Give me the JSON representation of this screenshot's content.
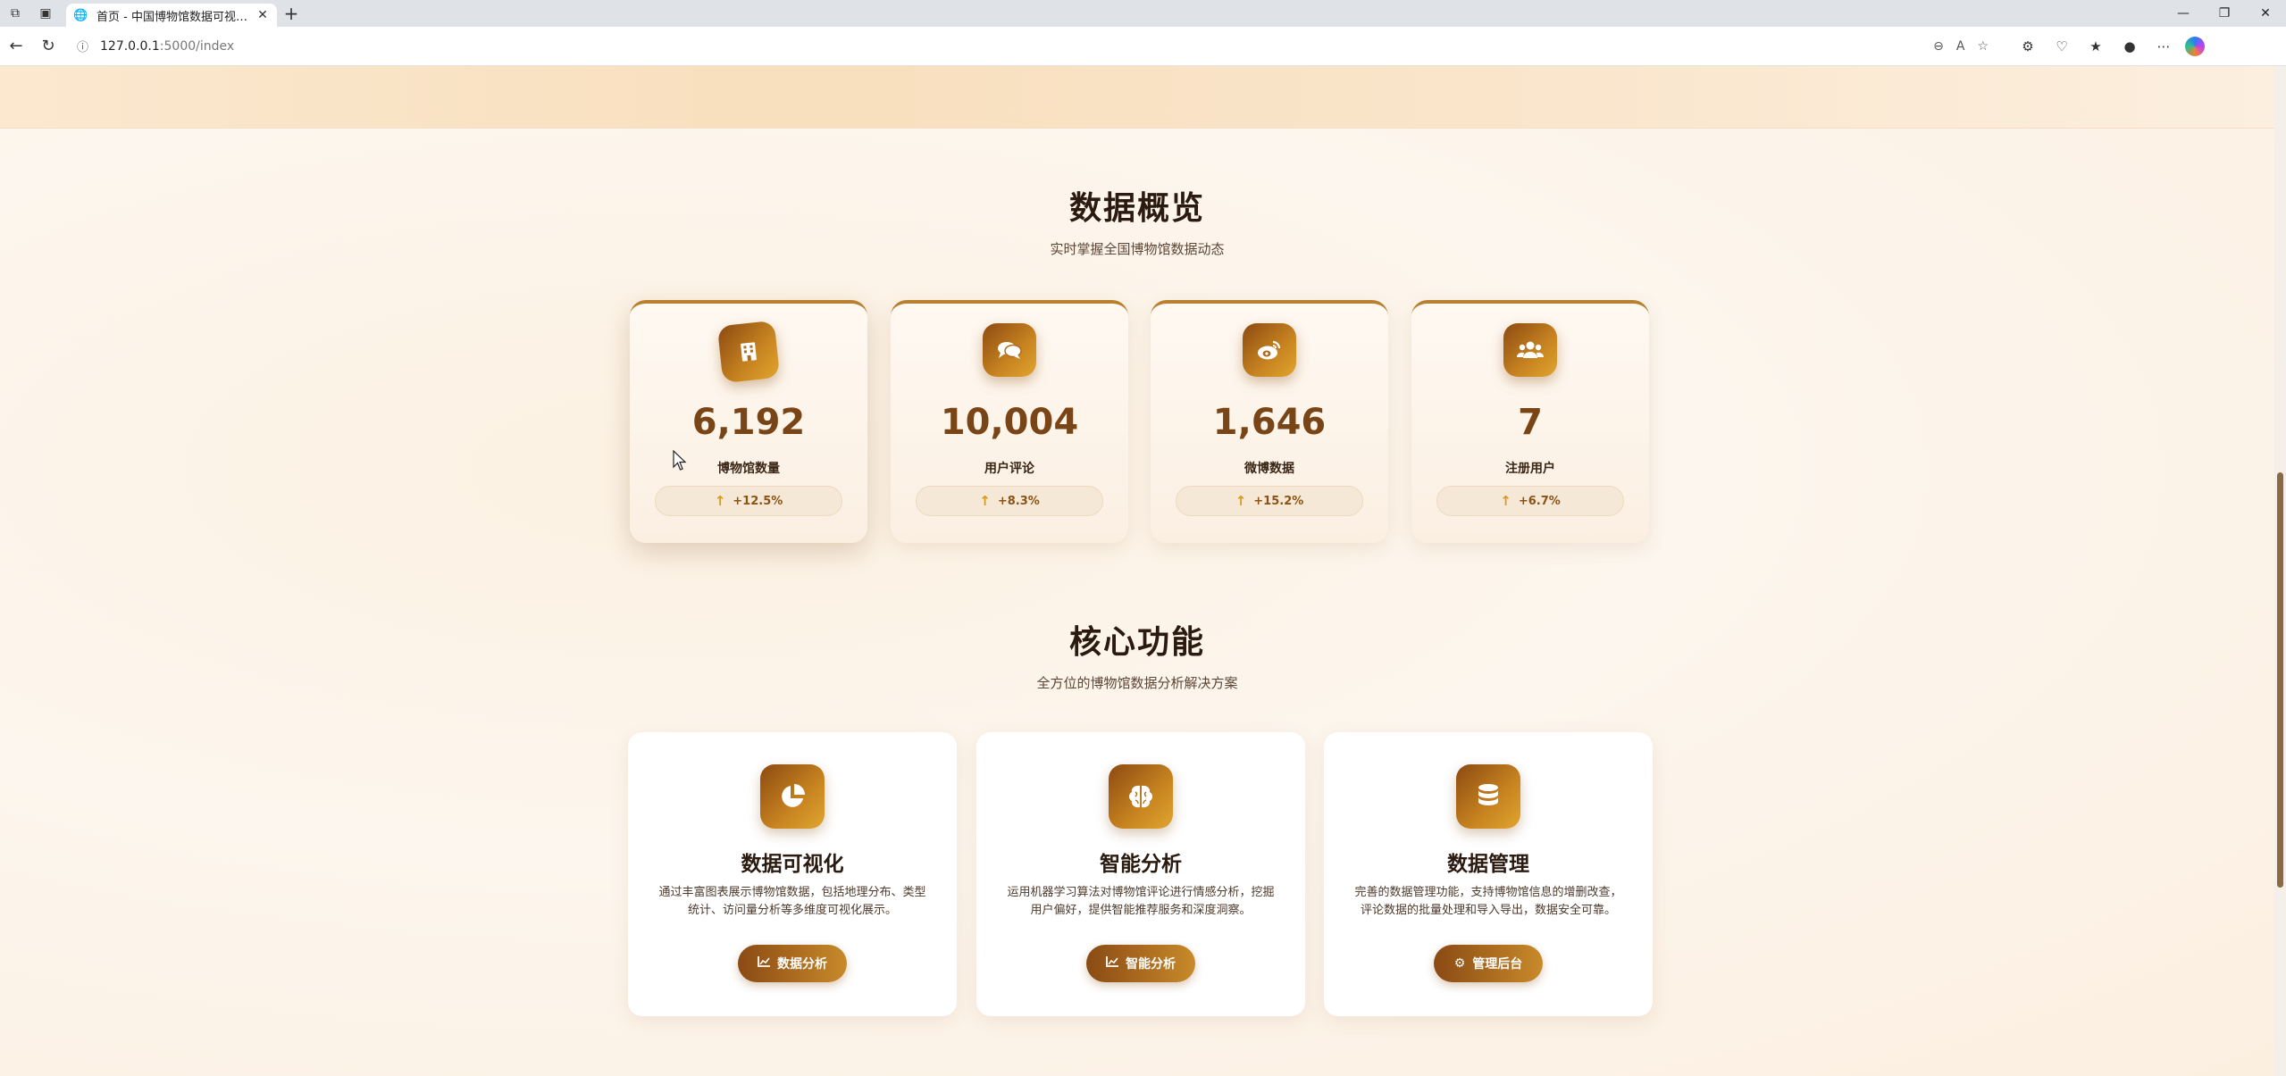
{
  "browser": {
    "tab_title": "首页 - 中国博物馆数据可视化分析",
    "url_host": "127.0.0.1",
    "url_path": ":5000/index"
  },
  "overview": {
    "title": "数据概览",
    "subtitle": "实时掌握全国博物馆数据动态",
    "stats": [
      {
        "value": "6,192",
        "label": "博物馆数量",
        "trend": "+12.5%",
        "icon": "building-icon"
      },
      {
        "value": "10,004",
        "label": "用户评论",
        "trend": "+8.3%",
        "icon": "comments-icon"
      },
      {
        "value": "1,646",
        "label": "微博数据",
        "trend": "+15.2%",
        "icon": "weibo-icon"
      },
      {
        "value": "7",
        "label": "注册用户",
        "trend": "+6.7%",
        "icon": "users-icon"
      }
    ]
  },
  "features": {
    "title": "核心功能",
    "subtitle": "全方位的博物馆数据分析解决方案",
    "items": [
      {
        "title": "数据可视化",
        "desc": "通过丰富图表展示博物馆数据，包括地理分布、类型统计、访问量分析等多维度可视化展示。",
        "button": "数据分析",
        "icon": "pie-chart-icon",
        "button_icon": "chart-icon"
      },
      {
        "title": "智能分析",
        "desc": "运用机器学习算法对博物馆评论进行情感分析，挖掘用户偏好，提供智能推荐服务和深度洞察。",
        "button": "智能分析",
        "icon": "brain-icon",
        "button_icon": "chart-icon"
      },
      {
        "title": "数据管理",
        "desc": "完善的数据管理功能，支持博物馆信息的增删改查，评论数据的批量处理和导入导出，数据安全可靠。",
        "button": "管理后台",
        "icon": "database-icon",
        "button_icon": "gear-icon"
      }
    ]
  },
  "colors": {
    "accent_dark": "#8c4a12",
    "accent_light": "#e0a530",
    "value_text": "#7a4516",
    "background": "#fbf4ea"
  }
}
